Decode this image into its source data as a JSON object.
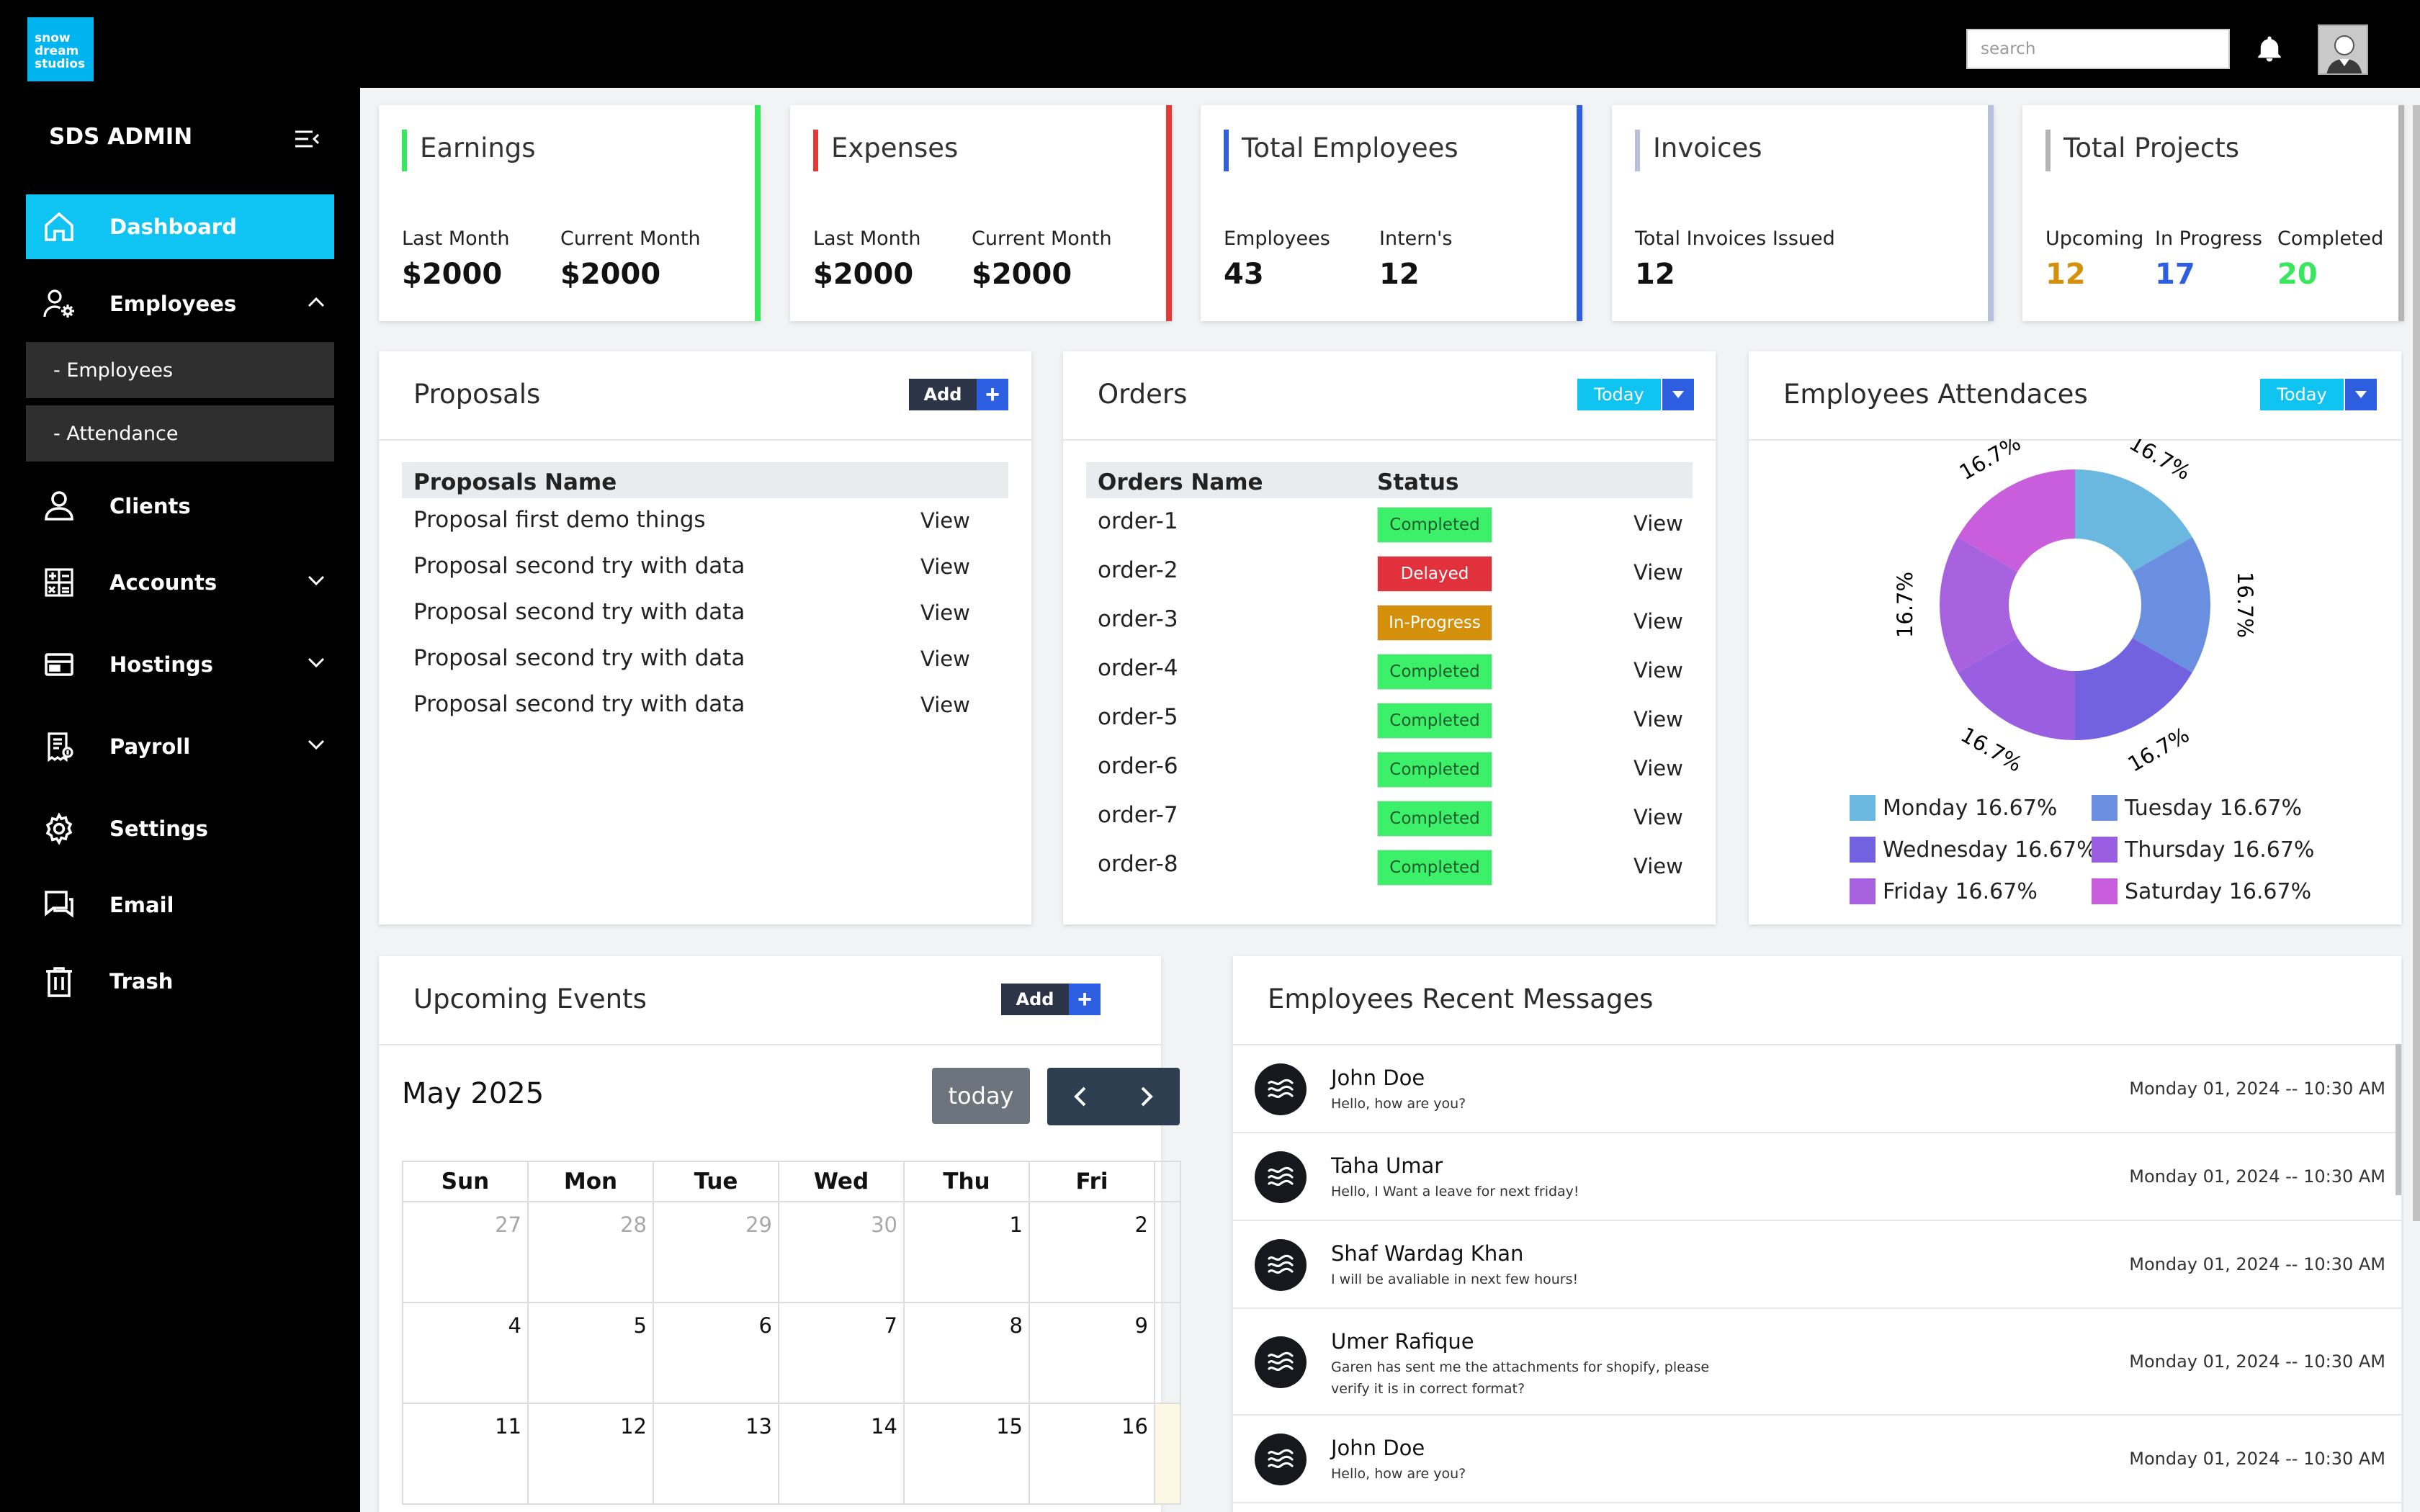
{
  "brand": {
    "logo_text": "snow\ndream\nstudios",
    "admin_title": "SDS ADMIN"
  },
  "header": {
    "search_placeholder": "search"
  },
  "sidebar": {
    "items": [
      {
        "label": "Dashboard",
        "icon": "home-icon"
      },
      {
        "label": "Employees",
        "icon": "users-gear-icon"
      },
      {
        "label": "Clients",
        "icon": "user-icon"
      },
      {
        "label": "Accounts",
        "icon": "calculator-icon"
      },
      {
        "label": "Hostings",
        "icon": "server-icon"
      },
      {
        "label": "Payroll",
        "icon": "receipt-icon"
      },
      {
        "label": "Settings",
        "icon": "gear-icon"
      },
      {
        "label": "Email",
        "icon": "chat-icon"
      },
      {
        "label": "Trash",
        "icon": "trash-icon"
      }
    ],
    "sub_items": [
      "- Employees",
      "- Attendance"
    ]
  },
  "stats": {
    "earnings": {
      "title": "Earnings",
      "l1": "Last Month",
      "v1": "$2000",
      "l2": "Current Month",
      "v2": "$2000",
      "color": "#39e75f"
    },
    "expenses": {
      "title": "Expenses",
      "l1": "Last Month",
      "v1": "$2000",
      "l2": "Current Month",
      "v2": "$2000",
      "color": "#e53935"
    },
    "employees": {
      "title": "Total Employees",
      "l1": "Employees",
      "v1": "43",
      "l2": "Intern's",
      "v2": "12",
      "color": "#2d5fe0"
    },
    "invoices": {
      "title": "Invoices",
      "l1": "Total Invoices Issued",
      "v1": "12",
      "color": "#b8bfd8"
    },
    "projects": {
      "title": "Total Projects",
      "l1": "Upcoming",
      "v1": "12",
      "l2": "In Progress",
      "v2": "17",
      "l3": "Completed",
      "v3": "20",
      "c1": "#d4900a",
      "c2": "#2d5fe0",
      "c3": "#39e75f",
      "color": "#b5b5b5"
    }
  },
  "proposals": {
    "title": "Proposals",
    "add": "Add",
    "plus": "+",
    "header": "Proposals Name",
    "rows": [
      "Proposal first demo things",
      "Proposal second try with data",
      "Proposal second try with data",
      "Proposal second try with data",
      "Proposal second try with data"
    ],
    "view": "View"
  },
  "orders": {
    "title": "Orders",
    "filter": "Today",
    "col_name": "Orders Name",
    "col_status": "Status",
    "view": "View",
    "rows": [
      {
        "name": "order-1",
        "status": "Completed"
      },
      {
        "name": "order-2",
        "status": "Delayed"
      },
      {
        "name": "order-3",
        "status": "In-Progress"
      },
      {
        "name": "order-4",
        "status": "Completed"
      },
      {
        "name": "order-5",
        "status": "Completed"
      },
      {
        "name": "order-6",
        "status": "Completed"
      },
      {
        "name": "order-7",
        "status": "Completed"
      },
      {
        "name": "order-8",
        "status": "Completed"
      }
    ]
  },
  "attendance": {
    "title": "Employees Attendaces",
    "filter": "Today",
    "slice_label": "16.7%"
  },
  "chart_data": {
    "type": "pie",
    "donut": true,
    "categories": [
      "Monday",
      "Tuesday",
      "Wednesday",
      "Thursday",
      "Friday",
      "Saturday"
    ],
    "values": [
      16.67,
      16.67,
      16.67,
      16.67,
      16.67,
      16.67
    ],
    "colors": [
      "#6ab8e0",
      "#6a8ee0",
      "#7262e0",
      "#9a5ee0",
      "#a862e0",
      "#c85edb"
    ],
    "legend": [
      "Monday 16.67%",
      "Tuesday 16.67%",
      "Wednesday 16.67%",
      "Thursday 16.67%",
      "Friday 16.67%",
      "Saturday 16.67%"
    ],
    "data_labels": [
      "16.7%",
      "16.7%",
      "16.7%",
      "16.7%",
      "16.7%",
      "16.7%"
    ],
    "legend_position": "bottom"
  },
  "events": {
    "title": "Upcoming Events",
    "add": "Add",
    "plus": "+",
    "month": "May 2025",
    "today": "today",
    "days": [
      "Sun",
      "Mon",
      "Tue",
      "Wed",
      "Thu",
      "Fri"
    ],
    "weeks": [
      [
        "27",
        "28",
        "29",
        "30",
        "1",
        "2"
      ],
      [
        "4",
        "5",
        "6",
        "7",
        "8",
        "9"
      ],
      [
        "11",
        "12",
        "13",
        "14",
        "15",
        "16"
      ]
    ]
  },
  "messages": {
    "title": "Employees Recent Messages",
    "items": [
      {
        "name": "John Doe",
        "text": "Hello, how are you?",
        "time": "Monday 01, 2024 -- 10:30 AM"
      },
      {
        "name": "Taha Umar",
        "text": "Hello, I Want a leave for next friday!",
        "time": "Monday 01, 2024 -- 10:30 AM"
      },
      {
        "name": "Shaf Wardag Khan",
        "text": "I will be avaliable in next few hours!",
        "time": "Monday 01, 2024 -- 10:30 AM"
      },
      {
        "name": "Umer Rafique",
        "text": "Garen has sent me the attachments for shopify, please verify it is in correct format?",
        "time": "Monday 01, 2024 -- 10:30 AM"
      },
      {
        "name": "John Doe",
        "text": "Hello, how are you?",
        "time": "Monday 01, 2024 -- 10:30 AM"
      }
    ]
  }
}
